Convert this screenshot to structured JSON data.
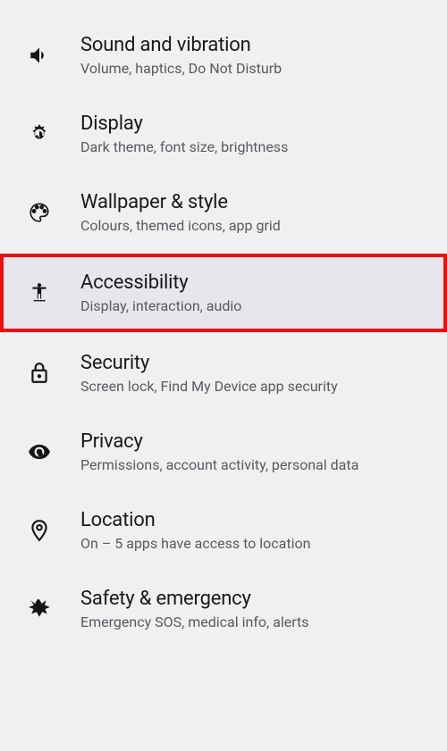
{
  "settings": [
    {
      "icon": "volume-icon",
      "title": "Sound and vibration",
      "subtitle": "Volume, haptics, Do Not Disturb",
      "highlighted": false
    },
    {
      "icon": "brightness-icon",
      "title": "Display",
      "subtitle": "Dark theme, font size, brightness",
      "highlighted": false
    },
    {
      "icon": "palette-icon",
      "title": "Wallpaper & style",
      "subtitle": "Colours, themed icons, app grid",
      "highlighted": false
    },
    {
      "icon": "accessibility-icon",
      "title": "Accessibility",
      "subtitle": "Display, interaction, audio",
      "highlighted": true
    },
    {
      "icon": "lock-icon",
      "title": "Security",
      "subtitle": "Screen lock, Find My Device app security",
      "highlighted": false
    },
    {
      "icon": "privacy-icon",
      "title": "Privacy",
      "subtitle": "Permissions, account activity, personal data",
      "highlighted": false
    },
    {
      "icon": "location-icon",
      "title": "Location",
      "subtitle": "On – 5 apps have access to location",
      "highlighted": false
    },
    {
      "icon": "emergency-icon",
      "title": "Safety & emergency",
      "subtitle": "Emergency SOS, medical info, alerts",
      "highlighted": false
    }
  ],
  "highlight_color": "#eb1010"
}
